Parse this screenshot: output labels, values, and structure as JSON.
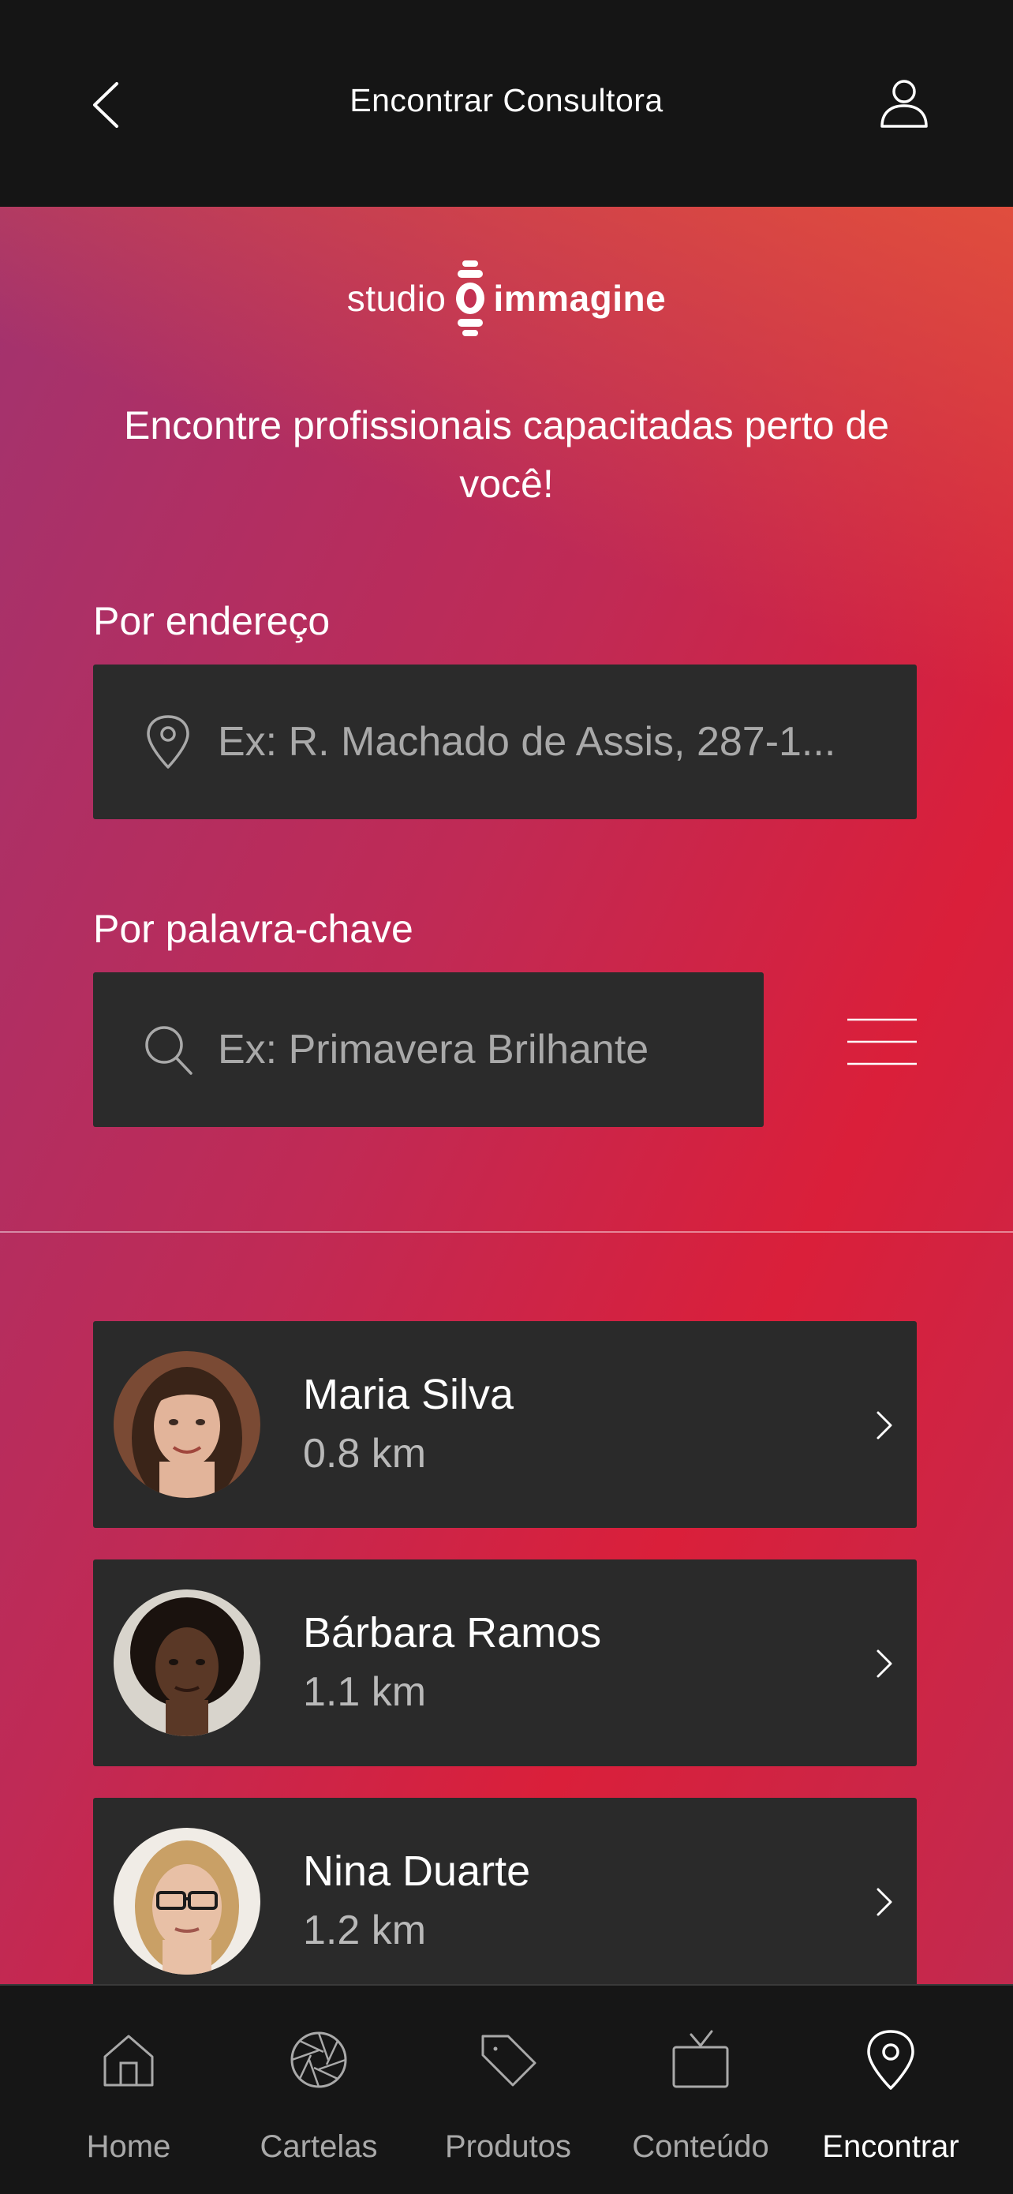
{
  "header": {
    "title": "Encontrar Consultora"
  },
  "logo": {
    "studio": "studio",
    "brand": "immagine"
  },
  "headline": "Encontre profissionais capacitadas perto de você!",
  "address": {
    "label": "Por endereço",
    "placeholder": "Ex: R. Machado de Assis, 287-1..."
  },
  "keyword": {
    "label": "Por palavra-chave",
    "placeholder": "Ex: Primavera Brilhante"
  },
  "consultants": [
    {
      "name": "Maria Silva",
      "distance": "0.8 km"
    },
    {
      "name": "Bárbara Ramos",
      "distance": "1.1 km"
    },
    {
      "name": "Nina Duarte",
      "distance": "1.2 km"
    }
  ],
  "tabs": [
    {
      "label": "Home",
      "icon": "home-icon"
    },
    {
      "label": "Cartelas",
      "icon": "aperture-icon"
    },
    {
      "label": "Produtos",
      "icon": "tag-icon"
    },
    {
      "label": "Conteúdo",
      "icon": "tv-icon"
    },
    {
      "label": "Encontrar",
      "icon": "location-pin-icon",
      "active": true
    }
  ],
  "colors": {
    "accent_gradient_start": "#a2336f",
    "accent_gradient_end": "#da1f3a",
    "card_bg": "#2a2a2a",
    "bar_bg": "#151515"
  }
}
